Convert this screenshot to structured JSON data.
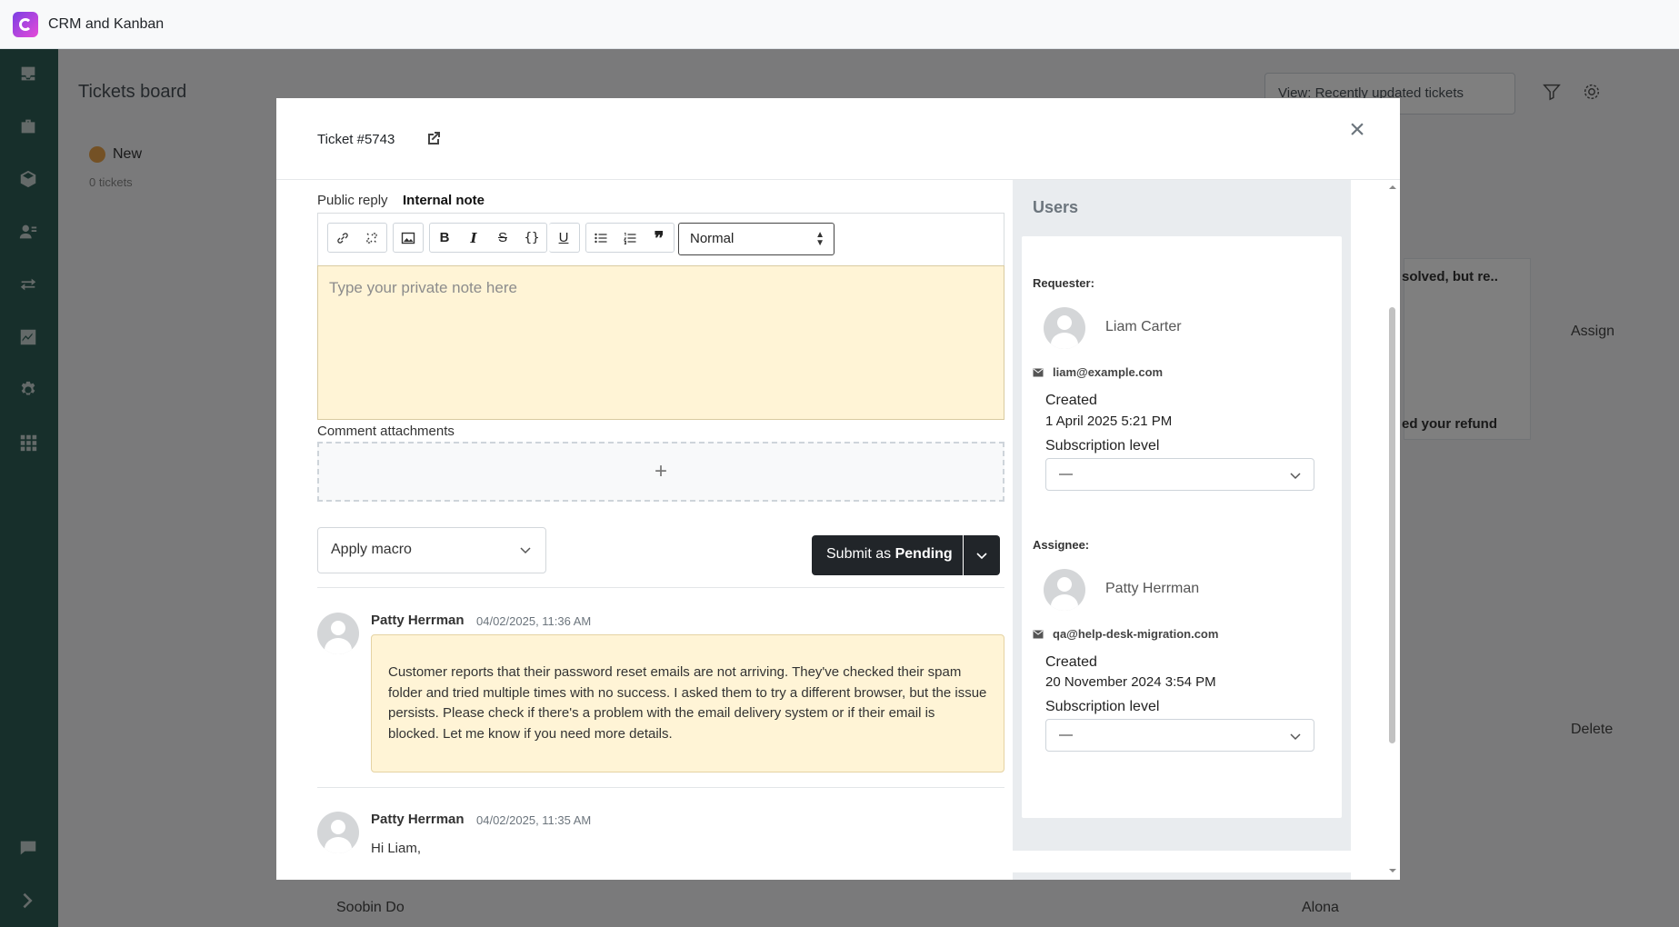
{
  "app": {
    "title": "CRM and Kanban"
  },
  "sidebar": {
    "icons": [
      "inbox-icon",
      "briefcase-icon",
      "cube-icon",
      "contacts-icon",
      "transfer-icon",
      "chart-icon",
      "settings-icon",
      "apps-icon",
      "chat-icon",
      "expand-icon"
    ]
  },
  "board": {
    "title": "Tickets board",
    "view_select": "View: Recently updated tickets",
    "columns": [
      {
        "label": "New",
        "count_text": "0 tickets"
      }
    ],
    "fragments": {
      "solved": "solved, but re..",
      "refund": "ed your refund",
      "assign": "Assign",
      "delete": "Delete",
      "card_user": "Soobin Do",
      "card_user2": "Alona"
    }
  },
  "modal": {
    "ticket_title": "Ticket #5743",
    "tabs": {
      "public": "Public reply",
      "internal": "Internal note"
    },
    "format_select": "Normal",
    "editor_placeholder": "Type your private note here",
    "attachments_label": "Comment attachments",
    "dropzone_symbol": "+",
    "macro_placeholder": "Apply macro",
    "submit": {
      "prefix": "Submit as",
      "status": "Pending"
    },
    "comments": [
      {
        "author": "Patty Herrman",
        "time": "04/02/2025, 11:36 AM",
        "text": "Customer reports that their password reset emails are not arriving. They've checked their spam folder and tried multiple times with no success. I asked them to try a different browser, but the issue persists. Please check if there's a problem with the email delivery system or if their email is blocked. Let me know if you need more details."
      },
      {
        "author": "Patty Herrman",
        "time": "04/02/2025, 11:35 AM",
        "text": "Hi Liam,"
      }
    ]
  },
  "users": {
    "title": "Users",
    "requester": {
      "label": "Requester:",
      "name": "Liam Carter",
      "email": "liam@example.com",
      "created_label": "Created",
      "created_value": "1 April 2025 5:21 PM",
      "subscription_label": "Subscription level",
      "subscription_value": "—"
    },
    "assignee": {
      "label": "Assignee:",
      "name": "Patty Herrman",
      "email": "qa@help-desk-migration.com",
      "created_label": "Created",
      "created_value": "20 November 2024 3:54 PM",
      "subscription_label": "Subscription level",
      "subscription_value": "—"
    }
  },
  "colors": {
    "sidebar": "#2f5f57",
    "note_background": "#fff4d6",
    "submit_button": "#212529"
  }
}
